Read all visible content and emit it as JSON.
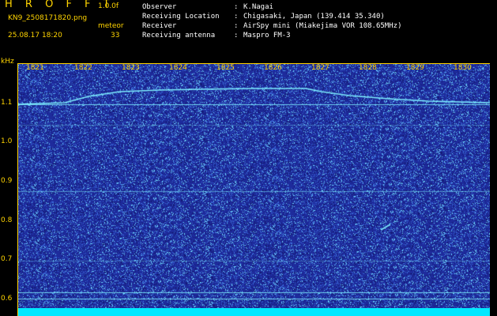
{
  "header": {
    "app_title": "H R O F F T",
    "version": "1.0.0f",
    "filename": "KN9_2508171820.png",
    "meteor_label": "meteor",
    "datetime": "25.08.17 18:20",
    "meteor_count": "33"
  },
  "info": {
    "observer_label": "Observer",
    "observer_value": "K.Nagai",
    "location_label": "Receiving Location",
    "location_value": "Chigasaki, Japan (139.414 35.340)",
    "receiver_label": "Receiver",
    "receiver_value": "AirSpy mini (Miakejima VOR 108.65MHz)",
    "antenna_label": "Receiving antenna",
    "antenna_value": "Maspro FM-3",
    "separator": ":"
  },
  "axis": {
    "y_unit": "kHz",
    "x_ticks": [
      "1821",
      "1822",
      "1823",
      "1824",
      "1825",
      "1826",
      "1827",
      "1828",
      "1829",
      "1830"
    ],
    "y_ticks": [
      "1.1",
      "1.0",
      "0.9",
      "0.8",
      "0.7",
      "0.6"
    ]
  },
  "colors": {
    "background": "#000000",
    "label": "#ffd400",
    "plot_bg": "#1e2b9c",
    "noise_light": "#6fd8ff",
    "trace": "#7ef0ff",
    "bottom_bar": "#00e8ff"
  }
}
